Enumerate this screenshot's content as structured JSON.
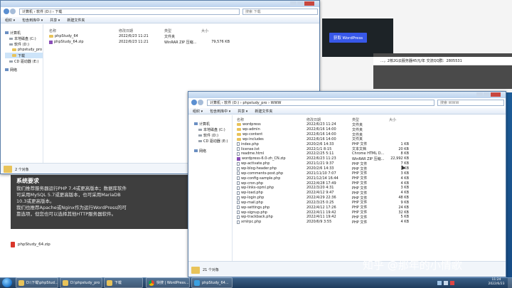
{
  "window1": {
    "address": "计算机 › 软件 (D:) › 下载",
    "search_placeholder": "搜索 下载",
    "toolbar": [
      "组织 ▾",
      "包含到库中 ▾",
      "共享 ▾",
      "新建文件夹"
    ],
    "nav": [
      "计算机",
      "本地磁盘 (C:)",
      "软件 (D:)",
      "phpstudy_pro",
      "下载",
      "CD 驱动器 (E:)",
      "网络"
    ],
    "columns": [
      "名称",
      "修改日期",
      "类型",
      "大小"
    ],
    "files": [
      {
        "name": "phpStudy_64",
        "date": "2022/6/23 11:21",
        "type": "文件夹",
        "size": ""
      },
      {
        "name": "phpStudy_64.zip",
        "date": "2022/6/23 11:21",
        "type": "WinRAR ZIP 压缩...",
        "size": "79,576 KB"
      }
    ],
    "status": "2 个对象"
  },
  "browser": {
    "button": "获取 WordPress",
    "line": "...，2核2G云服务器45元/年  交流QQ群：2805531"
  },
  "article": {
    "heading": "系统要求",
    "lines": [
      "我们推荐服务器运行PHP 7.4或更高版本；数据库软件",
      "可采用MySQL 5.7或更高版本，也可采用MariaDB",
      "10.3或更高版本。",
      "我们也推荐Apache或Nginx作为运行WordPress的可",
      "靠选项，但您也可以选择其他HTTP服务器软件。"
    ]
  },
  "download_item": "phpStudy_64.zip",
  "window2": {
    "address": "计算机 › 软件 (D:) › phpstudy_pro › WWW",
    "search_placeholder": "搜索 WWW",
    "toolbar": [
      "组织 ▾",
      "包含到库中 ▾",
      "共享 ▾",
      "新建文件夹"
    ],
    "nav": [
      "计算机",
      "本地磁盘 (C:)",
      "软件 (D:)",
      "CD 驱动器 (E:)",
      "网络"
    ],
    "columns": [
      "名称",
      "修改日期",
      "类型",
      "大小"
    ],
    "files": [
      {
        "name": "wordpress",
        "date": "2022/6/23 11:24",
        "type": "文件夹",
        "size": "",
        "kind": "folder"
      },
      {
        "name": "wp-admin",
        "date": "2022/6/16 14:00",
        "type": "文件夹",
        "size": "",
        "kind": "folder"
      },
      {
        "name": "wp-content",
        "date": "2022/6/16 14:00",
        "type": "文件夹",
        "size": "",
        "kind": "folder"
      },
      {
        "name": "wp-includes",
        "date": "2022/6/16 14:00",
        "type": "文件夹",
        "size": "",
        "kind": "folder"
      },
      {
        "name": "index.php",
        "date": "2020/2/6 14:33",
        "type": "PHP 文件",
        "size": "1 KB",
        "kind": "file"
      },
      {
        "name": "license.txt",
        "date": "2022/1/1 8:15",
        "type": "文本文档",
        "size": "20 KB",
        "kind": "file"
      },
      {
        "name": "readme.html",
        "date": "2022/2/25 5:11",
        "type": "Chrome HTML D...",
        "size": "8 KB",
        "kind": "file"
      },
      {
        "name": "wordpress-6.0-zh_CN.zip",
        "date": "2022/6/23 11:23",
        "type": "WinRAR ZIP 压缩...",
        "size": "22,992 KB",
        "kind": "zip"
      },
      {
        "name": "wp-activate.php",
        "date": "2021/1/21 9:37",
        "type": "PHP 文件",
        "size": "7 KB",
        "kind": "file"
      },
      {
        "name": "wp-blog-header.php",
        "date": "2020/2/6 14:33",
        "type": "PHP 文件",
        "size": "1 KB",
        "kind": "file"
      },
      {
        "name": "wp-comments-post.php",
        "date": "2021/11/10 7:07",
        "type": "PHP 文件",
        "size": "3 KB",
        "kind": "file"
      },
      {
        "name": "wp-config-sample.php",
        "date": "2021/12/14 16:44",
        "type": "PHP 文件",
        "size": "4 KB",
        "kind": "file"
      },
      {
        "name": "wp-cron.php",
        "date": "2022/4/28 17:49",
        "type": "PHP 文件",
        "size": "4 KB",
        "kind": "file"
      },
      {
        "name": "wp-links-opml.php",
        "date": "2022/3/20 4:31",
        "type": "PHP 文件",
        "size": "3 KB",
        "kind": "file"
      },
      {
        "name": "wp-load.php",
        "date": "2022/4/12 9:47",
        "type": "PHP 文件",
        "size": "4 KB",
        "kind": "file"
      },
      {
        "name": "wp-login.php",
        "date": "2022/4/29 22:36",
        "type": "PHP 文件",
        "size": "48 KB",
        "kind": "file"
      },
      {
        "name": "wp-mail.php",
        "date": "2022/3/25 0:25",
        "type": "PHP 文件",
        "size": "9 KB",
        "kind": "file"
      },
      {
        "name": "wp-settings.php",
        "date": "2022/4/12 17:26",
        "type": "PHP 文件",
        "size": "24 KB",
        "kind": "file"
      },
      {
        "name": "wp-signup.php",
        "date": "2022/4/11 19:42",
        "type": "PHP 文件",
        "size": "32 KB",
        "kind": "file"
      },
      {
        "name": "wp-trackback.php",
        "date": "2022/4/11 19:42",
        "type": "PHP 文件",
        "size": "5 KB",
        "kind": "file"
      },
      {
        "name": "xmlrpc.php",
        "date": "2020/6/9 3:55",
        "type": "PHP 文件",
        "size": "4 KB",
        "kind": "file"
      }
    ],
    "status": "21 个对象"
  },
  "watermark": "知乎 @那年的小情歌",
  "taskbar": {
    "items": [
      "D:\\下载\\phpStud...",
      "D:\\phpstudy_pro",
      "下载",
      "快搜 | WordPress...",
      "phpStudy_64..."
    ],
    "clock_time": "11:24",
    "clock_date": "2022/6/23"
  },
  "colors": {
    "wp_button": "#3858e9",
    "accent": "#1e6fb8"
  }
}
